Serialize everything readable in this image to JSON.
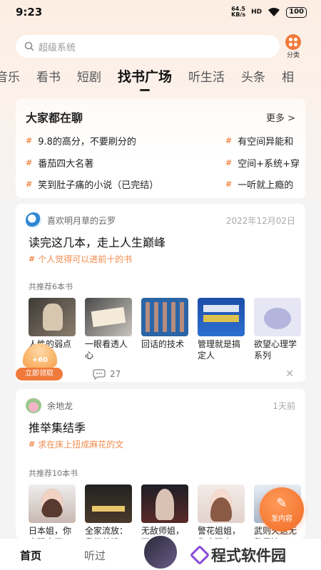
{
  "status_bar": {
    "time": "9:23",
    "net_speed_value": "64.5",
    "net_speed_unit": "KB/s",
    "signal": "HD",
    "battery": "100"
  },
  "search": {
    "placeholder": "超级系统"
  },
  "category_button": {
    "label": "分类"
  },
  "tabs": [
    {
      "label": "音乐"
    },
    {
      "label": "看书"
    },
    {
      "label": "短剧"
    },
    {
      "label": "找书广场",
      "active": true
    },
    {
      "label": "听生活"
    },
    {
      "label": "头条"
    },
    {
      "label": "相"
    }
  ],
  "chat_section": {
    "title": "大家都在聊",
    "more_label": "更多 >",
    "topics_left": [
      "9.8的高分，不要刷分的",
      "番茄四大名著",
      "笑到肚子痛的小说（已完结）"
    ],
    "topics_right": [
      "有空间异能和",
      "空间+系统+穿",
      "一听就上瘾的"
    ]
  },
  "posts": [
    {
      "user": "喜欢明月草的云罗",
      "date": "2022年12月02日",
      "title": "读完这几本，走上人生巅峰",
      "subtitle": "个人觉得可以进前十的书",
      "rec_label": "共推荐6本书",
      "books": [
        "人性的弱点",
        "一眼看透人心",
        "回话的技术",
        "管理就是搞定人",
        "欲望心理学系列"
      ],
      "comments": "27"
    },
    {
      "user": "余地龙",
      "date": "1天前",
      "title": "推举集结季",
      "subtitle": "求在床上扭成麻花的文",
      "rec_label": "共推荐10本书",
      "books": [
        "日本姐，你太强大了…",
        "全家流放：我带着嫂…",
        "无敌师姐，不要停",
        "警花姐姐，你太强大…",
        "武则天这无敌风流"
      ]
    }
  ],
  "reward": {
    "amount": "+60",
    "button": "立即领取"
  },
  "fab": {
    "label": "发内容"
  },
  "bottom_nav": {
    "home": "首页",
    "listened": "听过",
    "watermark": "程式软件园"
  },
  "colors": {
    "accent": "#f07a3c",
    "hash": "#f08a4b"
  }
}
